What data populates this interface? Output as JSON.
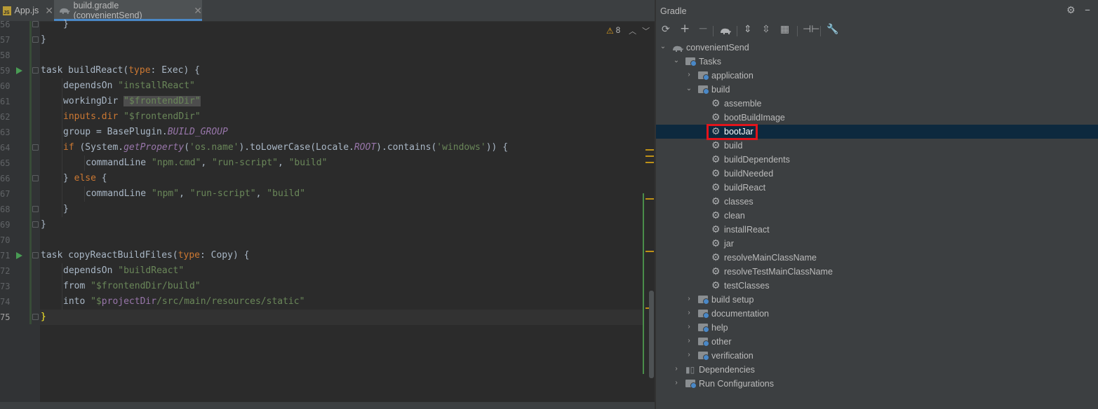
{
  "tabs": [
    {
      "label": "App.js",
      "active": false,
      "icon": "js-file-icon"
    },
    {
      "label": "build.gradle (convenientSend)",
      "active": true,
      "icon": "gradle-elephant-icon"
    }
  ],
  "editor": {
    "warnings_count": "8",
    "current_line": "75",
    "line_numbers": [
      "56",
      "57",
      "58",
      "59",
      "60",
      "61",
      "62",
      "63",
      "64",
      "65",
      "66",
      "67",
      "68",
      "69",
      "70",
      "71",
      "72",
      "73",
      "74",
      "75"
    ]
  },
  "code": {
    "l56": "}",
    "l57": "}",
    "l59": {
      "kw": "task",
      "name": " buildReact(",
      "type": "type",
      "rest": ": Exec) {"
    },
    "l60": {
      "a": "dependsOn ",
      "s": "\"installReact\""
    },
    "l61": {
      "a": "workingDir ",
      "s": "\"$frontendDir\""
    },
    "l62": {
      "a": "inputs.dir",
      "s": " \"$frontendDir\""
    },
    "l63": {
      "a": "group = BasePlugin.",
      "c": "BUILD_GROUP"
    },
    "l64": {
      "kw": "if",
      "a": " (System.",
      "m": "getProperty",
      "b": "(",
      "s1": "'os.name'",
      "c": ").toLowerCase(Locale.",
      "root": "ROOT",
      "d": ").contains(",
      "s2": "'windows'",
      "e": ")) {"
    },
    "l65": {
      "a": "commandLine ",
      "s1": "\"npm.cmd\"",
      "c1": ", ",
      "s2": "\"run-script\"",
      "c2": ", ",
      "s3": "\"build\""
    },
    "l66": {
      "a": "} ",
      "kw": "else",
      "b": " {"
    },
    "l67": {
      "a": "commandLine ",
      "s1": "\"npm\"",
      "c1": ", ",
      "s2": "\"run-script\"",
      "c2": ", ",
      "s3": "\"build\""
    },
    "l68": "}",
    "l69": "}",
    "l71": {
      "kw": "task",
      "name": " copyReactBuildFiles(",
      "type": "type",
      "rest": ": Copy) {"
    },
    "l72": {
      "a": "dependsOn ",
      "s": "\"buildReact\""
    },
    "l73": {
      "a": "from ",
      "s": "\"$frontendDir/build\""
    },
    "l74": {
      "a": "into ",
      "s1": "\"$",
      "p": "projectDir",
      "s2": "/src/main/resources/static\""
    },
    "l75": "}"
  },
  "gradle": {
    "title": "Gradle",
    "tree": {
      "root": "convenientSend",
      "tasks": "Tasks",
      "application": "application",
      "build": "build",
      "build_tasks": [
        "assemble",
        "bootBuildImage",
        "bootJar",
        "build",
        "buildDependents",
        "buildNeeded",
        "buildReact",
        "classes",
        "clean",
        "installReact",
        "jar",
        "resolveMainClassName",
        "resolveTestMainClassName",
        "testClasses"
      ],
      "build_setup": "build setup",
      "documentation": "documentation",
      "help": "help",
      "other": "other",
      "verification": "verification",
      "dependencies": "Dependencies",
      "run_configurations": "Run Configurations"
    },
    "selected_task": "bootJar"
  },
  "colors": {
    "highlight": "#e3141b",
    "selection": "#0d293e",
    "accent": "#4a88c7"
  }
}
